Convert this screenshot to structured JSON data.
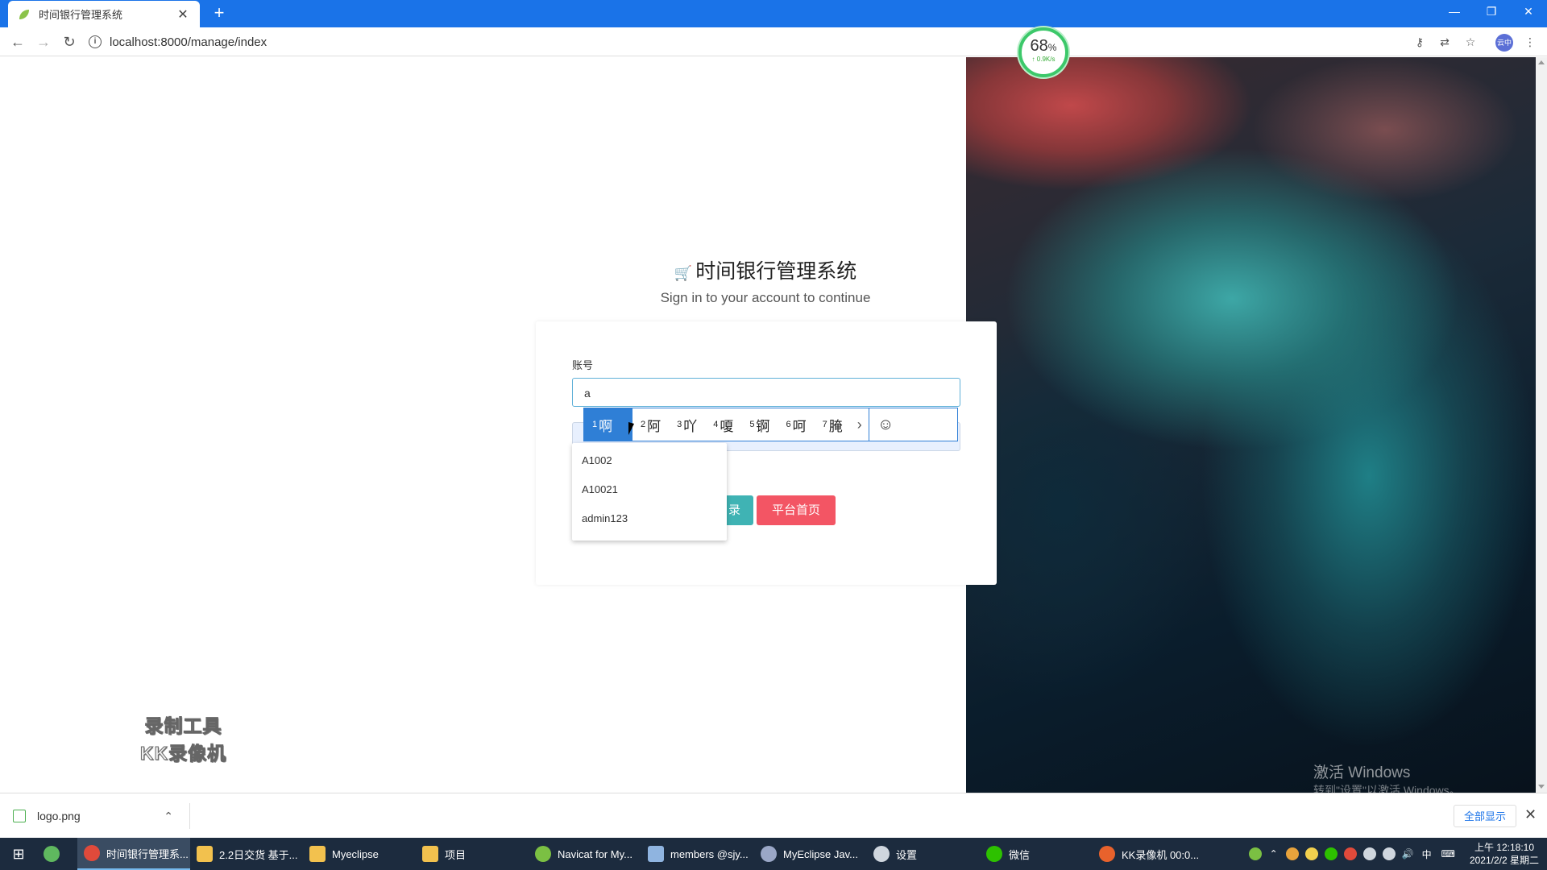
{
  "browser": {
    "tab_title": "时间银行管理系统",
    "tab_close": "✕",
    "new_tab": "+",
    "url": "localhost:8000/manage/index",
    "profile_label": "云中"
  },
  "speed_badge": {
    "percent": "68",
    "unit": "%",
    "rate": "↑ 0.9K/s"
  },
  "login": {
    "brand_icon": "🛒",
    "title": "时间银行管理系统",
    "subtitle": "Sign in to your account to continue",
    "account_label": "账号",
    "account_value": "a",
    "login_button": "录",
    "home_button": "平台首页"
  },
  "autocomplete": [
    "A1002",
    "A10021",
    "admin123"
  ],
  "ime": {
    "candidates": [
      {
        "num": "1",
        "char": "啊"
      },
      {
        "num": "2",
        "char": "阿"
      },
      {
        "num": "3",
        "char": "吖"
      },
      {
        "num": "4",
        "char": "嗄"
      },
      {
        "num": "5",
        "char": "锕"
      },
      {
        "num": "6",
        "char": "呵"
      },
      {
        "num": "7",
        "char": "腌"
      }
    ],
    "selected_index": 0,
    "next": "›",
    "emoji": "☺"
  },
  "recorder_watermark": {
    "line1": "录制工具",
    "line2": "KK录像机"
  },
  "windows_watermark": {
    "line1": "激活 Windows",
    "line2": "转到\"设置\"以激活 Windows。"
  },
  "download_bar": {
    "file_name": "logo.png",
    "show_all": "全部显示",
    "close": "✕"
  },
  "taskbar": {
    "apps": [
      {
        "label": "时间银行管理系...",
        "active": true,
        "color": "#e04a3b"
      },
      {
        "label": "2.2日交货 基于...",
        "active": false,
        "color": "#f2c14e"
      },
      {
        "label": "Myeclipse",
        "active": false,
        "color": "#f2c14e"
      },
      {
        "label": "项目",
        "active": false,
        "color": "#f2c14e"
      },
      {
        "label": "Navicat for My...",
        "active": false,
        "color": "#7bc043"
      },
      {
        "label": "members @sjy...",
        "active": false,
        "color": "#8fb4e0"
      },
      {
        "label": "MyEclipse Jav...",
        "active": false,
        "color": "#9aa7c7"
      },
      {
        "label": "设置",
        "active": false,
        "color": "#cfd6de"
      },
      {
        "label": "微信",
        "active": false,
        "color": "#2dc100"
      },
      {
        "label": "KK录像机 00:0...",
        "active": false,
        "color": "#e8622c"
      }
    ],
    "tray_lang": "中",
    "time": "上午 12:18:10",
    "date": "2021/2/2 星期二"
  }
}
